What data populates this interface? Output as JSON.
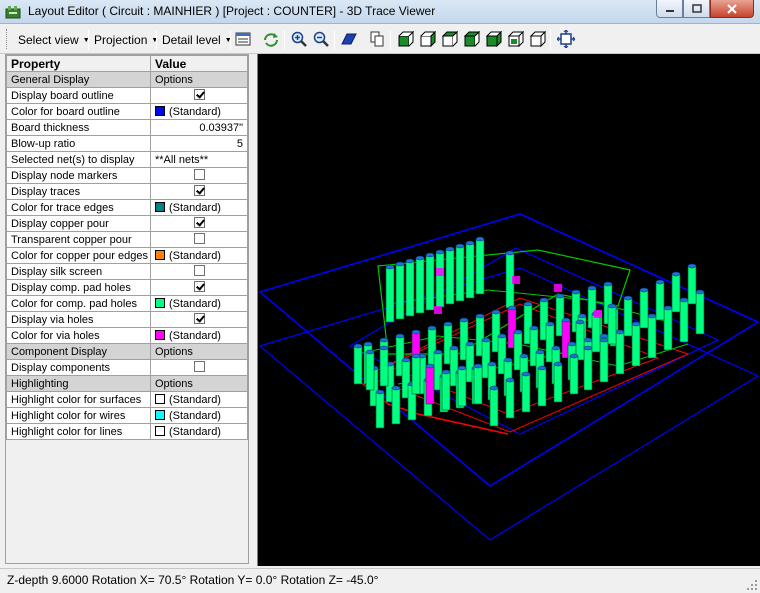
{
  "window": {
    "title": "Layout Editor ( Circuit : MAINHIER ) [Project : COUNTER] - 3D Trace Viewer"
  },
  "toolbar": {
    "select_view": "Select view",
    "projection": "Projection",
    "detail_level": "Detail level",
    "icons": [
      "properties-icon",
      "refresh-icon",
      "zoom-in-icon",
      "zoom-out-icon",
      "board-view-icon",
      "copy-icon",
      "cube-front-icon",
      "cube-back-icon",
      "cube-top-icon",
      "cube-bottom-icon",
      "cube-left-icon",
      "cube-right-icon",
      "cube-iso-icon",
      "fit-view-icon"
    ]
  },
  "grid": {
    "header": {
      "property": "Property",
      "value": "Value"
    },
    "rows": [
      {
        "property": "General Display",
        "value": "Options",
        "kind": "section"
      },
      {
        "property": "Display board outline",
        "kind": "check",
        "checked": true
      },
      {
        "property": "Color for board outline",
        "value": "(Standard)",
        "kind": "color",
        "color": "#0000ff"
      },
      {
        "property": "Board thickness",
        "value": "0.03937\"",
        "kind": "number"
      },
      {
        "property": "Blow-up ratio",
        "value": "5",
        "kind": "number"
      },
      {
        "property": "Selected net(s) to display",
        "value": "**All nets**",
        "kind": "text"
      },
      {
        "property": "Display node markers",
        "kind": "check",
        "checked": false
      },
      {
        "property": "Display traces",
        "kind": "check",
        "checked": true
      },
      {
        "property": "Color for trace edges",
        "value": "(Standard)",
        "kind": "color",
        "color": "#008080"
      },
      {
        "property": "Display copper pour",
        "kind": "check",
        "checked": true
      },
      {
        "property": "Transparent copper pour",
        "kind": "check",
        "checked": false
      },
      {
        "property": "Color for copper pour edges",
        "value": "(Standard)",
        "kind": "color",
        "color": "#ff8000"
      },
      {
        "property": "Display silk screen",
        "kind": "check",
        "checked": false
      },
      {
        "property": "Display comp. pad holes",
        "kind": "check",
        "checked": true
      },
      {
        "property": "Color for comp. pad holes",
        "value": "(Standard)",
        "kind": "color",
        "color": "#00ff80"
      },
      {
        "property": "Display via holes",
        "kind": "check",
        "checked": true
      },
      {
        "property": "Color for via holes",
        "value": "(Standard)",
        "kind": "color",
        "color": "#ff00ff"
      },
      {
        "property": "Component Display",
        "value": "Options",
        "kind": "section"
      },
      {
        "property": "Display components",
        "kind": "check",
        "checked": false
      },
      {
        "property": "Highlighting",
        "value": "Options",
        "kind": "section"
      },
      {
        "property": "Highlight color for surfaces",
        "value": "(Standard)",
        "kind": "color",
        "color": "#ffffff"
      },
      {
        "property": "Highlight color for wires",
        "value": "(Standard)",
        "kind": "color",
        "color": "#00ffff"
      },
      {
        "property": "Highlight color for lines",
        "value": "(Standard)",
        "kind": "color",
        "color": "#ffffff"
      }
    ]
  },
  "viewer": {
    "colors": {
      "background": "#000000",
      "board_outline": "#0000ff",
      "pins": "#00ff80",
      "vias": "#ff00ff",
      "traces": "#00c800",
      "copper": "#ff0000"
    }
  },
  "status": {
    "text": "Z-depth 9.6000   Rotation X= 70.5° Rotation Y= 0.0° Rotation Z= -45.0°"
  }
}
